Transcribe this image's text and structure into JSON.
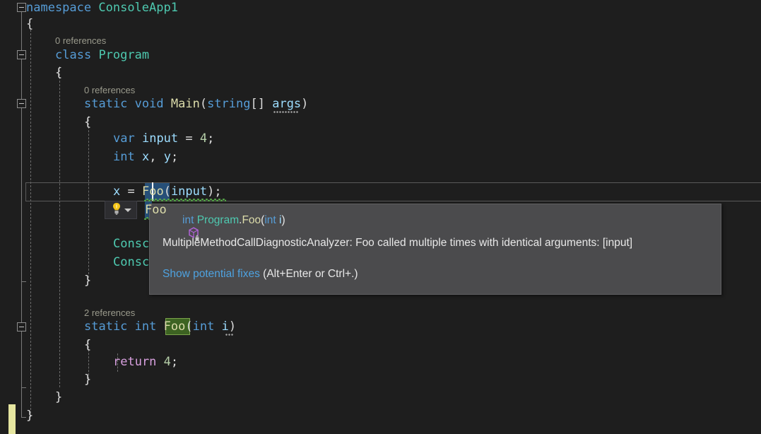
{
  "editor": {
    "language": "csharp",
    "theme": "dark",
    "colors": {
      "background": "#1e1e1e",
      "keyword": "#569cd6",
      "type": "#4ec9b0",
      "identifier": "#9cdcfe",
      "method": "#dcdcaa",
      "number": "#b5cea8",
      "control": "#d8a0df",
      "codelens": "#9a9a8c",
      "selection": "#264f78",
      "reference_highlight": "#3d6322",
      "squiggle": "#57a64a",
      "change_bar": "#e6e6a0",
      "tooltip_background": "#4b4b4d",
      "link": "#4ea2e0"
    },
    "codelens": [
      {
        "text": "0 references",
        "target": "class Program"
      },
      {
        "text": "0 references",
        "target": "static void Main(string[] args)"
      },
      {
        "text": "2 references",
        "target": "static int Foo(int i)"
      }
    ],
    "lines": [
      "namespace ConsoleApp1",
      "{",
      "    class Program",
      "    {",
      "        static void Main(string[] args)",
      "        {",
      "            var input = 4;",
      "            int x, y;",
      "",
      "            x = Foo(input);",
      "            y = Foo(input);",
      "",
      "            Console.WriteLine(x);",
      "            Console.WriteLine(y);",
      "        }",
      "",
      "        static int Foo(int i)",
      "        {",
      "            return 4;",
      "        }",
      "    }",
      "}"
    ],
    "tokens": {
      "namespace_kw": "namespace",
      "namespace_name": "ConsoleApp1",
      "class_kw": "class",
      "class_name": "Program",
      "static_kw": "static",
      "void_kw": "void",
      "main_name": "Main",
      "string_kw": "string",
      "args_name": "args",
      "var_kw": "var",
      "input_name": "input",
      "int_kw": "int",
      "x_name": "x",
      "y_name": "y",
      "foo_name": "Foo",
      "console_name": "Consc",
      "return_kw": "return",
      "i_name": "i",
      "four": "4",
      "open_brace": "{",
      "close_brace": "}"
    },
    "selected_text": "Foo",
    "caret_position": "inside Foo on line x = Foo(input);"
  },
  "quick_actions": {
    "lightbulb_label": "lightbulb-icon",
    "dropdown_label": "chevron-down-icon"
  },
  "tooltip": {
    "signature": {
      "return_type": "int",
      "containing_type": "Program",
      "dot": ".",
      "method": "Foo",
      "open_paren": "(",
      "param_type": "int",
      "param_space": " ",
      "param_name": "i",
      "close_paren": ")"
    },
    "icon_name": "method-icon-private",
    "diagnostic": "MultipleMethodCallDiagnosticAnalyzer: Foo called multiple times with identical arguments: [input]",
    "fix_link": "Show potential fixes",
    "fix_hint": " (Alt+Enter or Ctrl+.)"
  }
}
